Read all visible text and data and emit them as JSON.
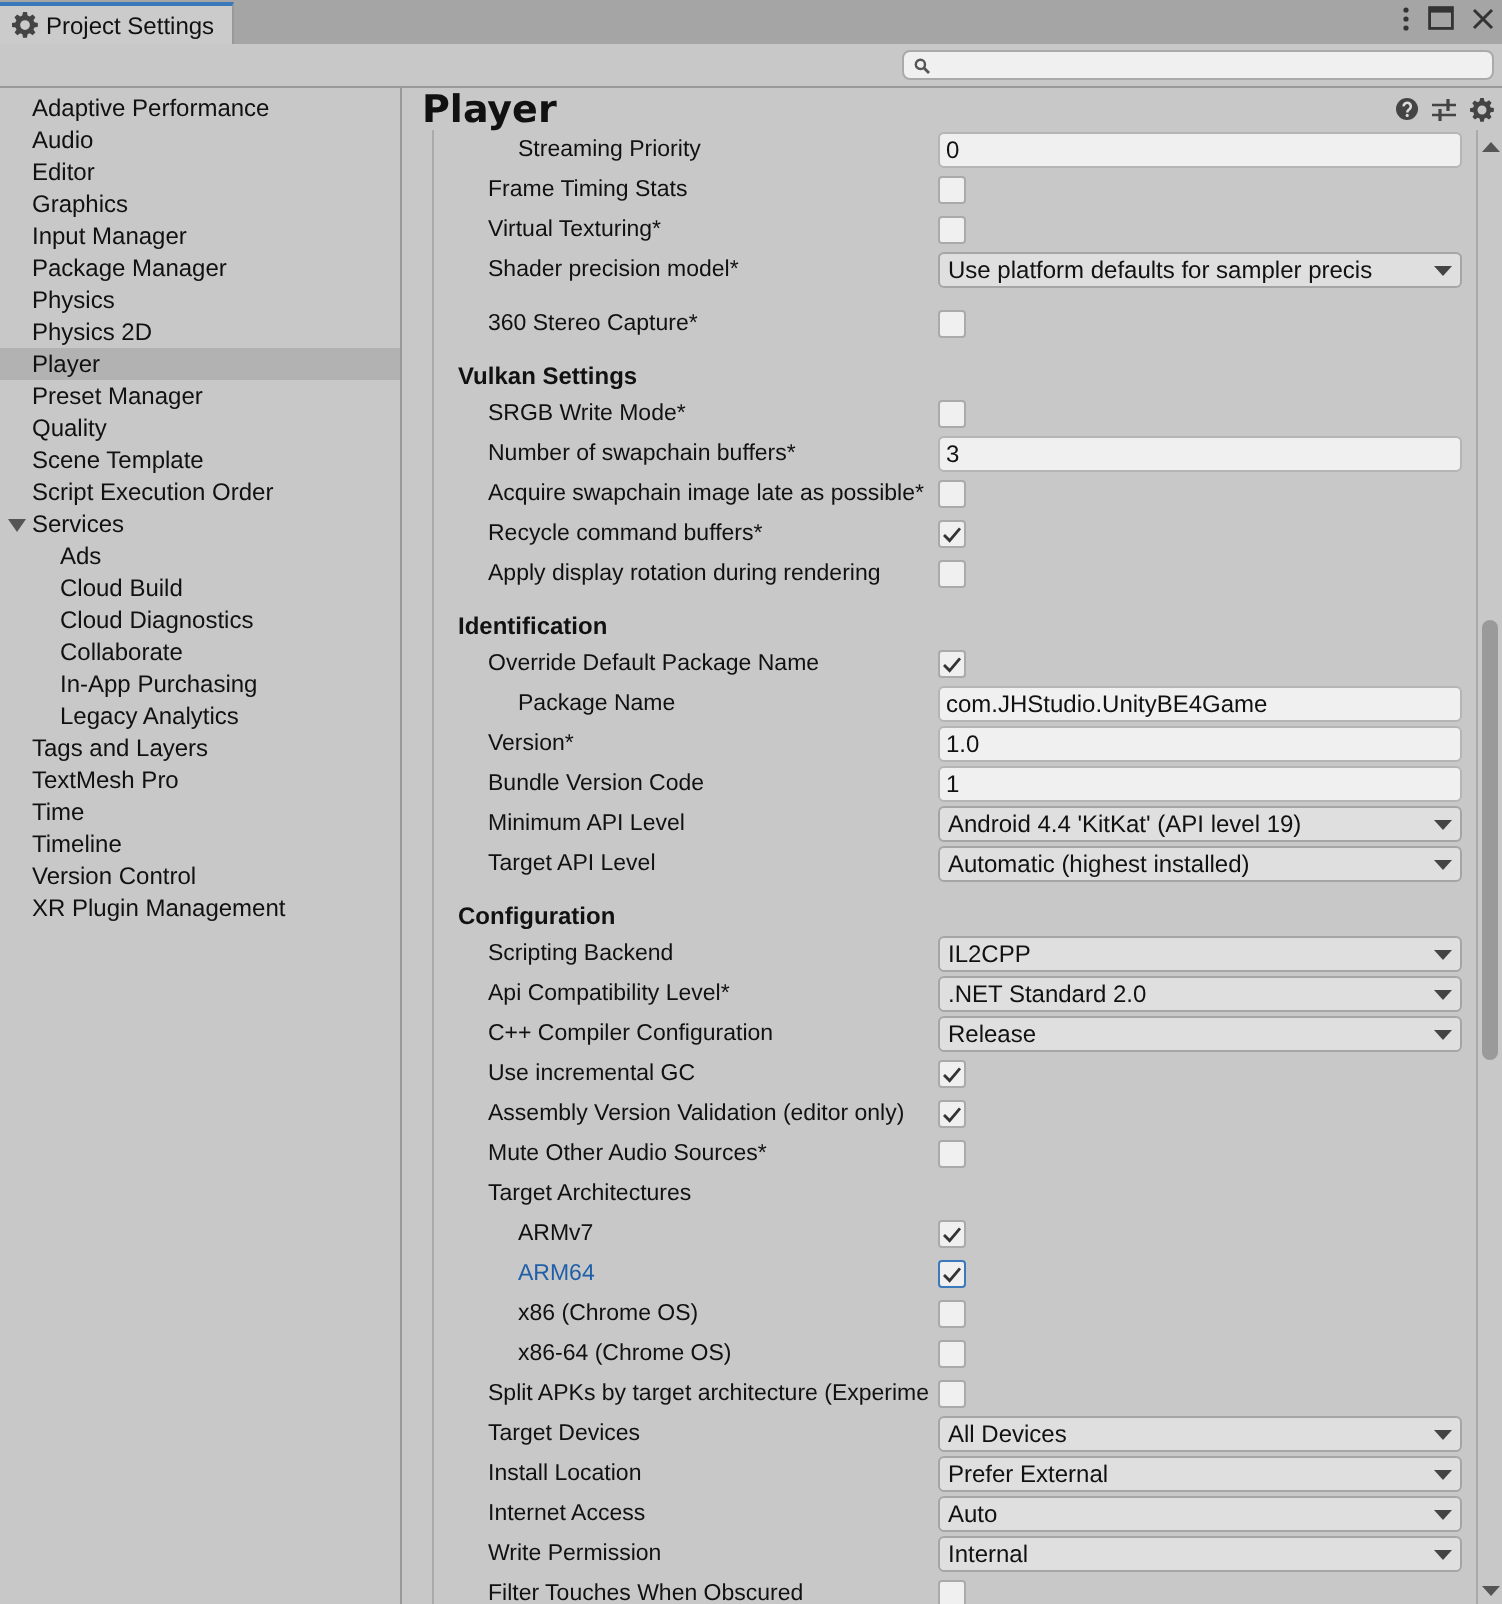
{
  "tab": {
    "title": "Project Settings"
  },
  "sidebar": {
    "items": [
      {
        "label": "Adaptive Performance",
        "selected": false
      },
      {
        "label": "Audio",
        "selected": false
      },
      {
        "label": "Editor",
        "selected": false
      },
      {
        "label": "Graphics",
        "selected": false
      },
      {
        "label": "Input Manager",
        "selected": false
      },
      {
        "label": "Package Manager",
        "selected": false
      },
      {
        "label": "Physics",
        "selected": false
      },
      {
        "label": "Physics 2D",
        "selected": false
      },
      {
        "label": "Player",
        "selected": true
      },
      {
        "label": "Preset Manager",
        "selected": false
      },
      {
        "label": "Quality",
        "selected": false
      },
      {
        "label": "Scene Template",
        "selected": false
      },
      {
        "label": "Script Execution Order",
        "selected": false
      },
      {
        "label": "Services",
        "selected": false,
        "expanded": true,
        "children": [
          {
            "label": "Ads",
            "selected": false
          },
          {
            "label": "Cloud Build",
            "selected": false
          },
          {
            "label": "Cloud Diagnostics",
            "selected": false
          },
          {
            "label": "Collaborate",
            "selected": false
          },
          {
            "label": "In-App Purchasing",
            "selected": false
          },
          {
            "label": "Legacy Analytics",
            "selected": false
          }
        ]
      },
      {
        "label": "Tags and Layers",
        "selected": false
      },
      {
        "label": "TextMesh Pro",
        "selected": false
      },
      {
        "label": "Time",
        "selected": false
      },
      {
        "label": "Timeline",
        "selected": false
      },
      {
        "label": "Version Control",
        "selected": false
      },
      {
        "label": "XR Plugin Management",
        "selected": false
      }
    ]
  },
  "inspector": {
    "title": "Player",
    "sections": [
      {
        "rows": [
          {
            "kind": "group",
            "children": [
              {
                "kind": "field",
                "label": "Streaming Priority",
                "value": "0"
              }
            ]
          },
          {
            "kind": "checkbox",
            "label": "Frame Timing Stats",
            "checked": false
          },
          {
            "kind": "checkbox",
            "label": "Virtual Texturing*",
            "checked": false
          },
          {
            "kind": "dropdown",
            "label": "Shader precision model*",
            "value": "Use platform defaults for sampler precis"
          }
        ]
      },
      {
        "rows": [
          {
            "kind": "checkbox",
            "label": "360 Stereo Capture*",
            "checked": false
          }
        ]
      },
      {
        "title": "Vulkan Settings",
        "rows": [
          {
            "kind": "checkbox",
            "label": "SRGB Write Mode*",
            "checked": false
          },
          {
            "kind": "field",
            "label": "Number of swapchain buffers*",
            "value": "3"
          },
          {
            "kind": "checkbox",
            "label": "Acquire swapchain image late as possible*",
            "checked": false
          },
          {
            "kind": "checkbox",
            "label": "Recycle command buffers*",
            "checked": true
          },
          {
            "kind": "checkbox",
            "label": "Apply display rotation during rendering",
            "checked": false
          }
        ]
      },
      {
        "title": "Identification",
        "rows": [
          {
            "kind": "checkbox",
            "label": "Override Default Package Name",
            "checked": true,
            "children": [
              {
                "kind": "field",
                "label": "Package Name",
                "value": "com.JHStudio.UnityBE4Game"
              }
            ]
          },
          {
            "kind": "field",
            "label": "Version*",
            "value": "1.0"
          },
          {
            "kind": "field",
            "label": "Bundle Version Code",
            "value": "1"
          },
          {
            "kind": "dropdown",
            "label": "Minimum API Level",
            "value": "Android 4.4 'KitKat' (API level 19)"
          },
          {
            "kind": "dropdown",
            "label": "Target API Level",
            "value": "Automatic (highest installed)"
          }
        ]
      },
      {
        "title": "Configuration",
        "rows": [
          {
            "kind": "dropdown",
            "label": "Scripting Backend",
            "value": "IL2CPP"
          },
          {
            "kind": "dropdown",
            "label": "Api Compatibility Level*",
            "value": ".NET Standard 2.0"
          },
          {
            "kind": "dropdown",
            "label": "C++ Compiler Configuration",
            "value": "Release"
          },
          {
            "kind": "checkbox",
            "label": "Use incremental GC",
            "checked": true
          },
          {
            "kind": "checkbox",
            "label": "Assembly Version Validation (editor only)",
            "checked": true
          },
          {
            "kind": "checkbox",
            "label": "Mute Other Audio Sources*",
            "checked": false
          },
          {
            "kind": "label",
            "label": "Target Architectures",
            "children": [
              {
                "kind": "checkbox",
                "label": "ARMv7",
                "checked": true,
                "focused": false
              },
              {
                "kind": "checkbox",
                "label": "ARM64",
                "checked": true,
                "focused": true
              },
              {
                "kind": "checkbox",
                "label": "x86 (Chrome OS)",
                "checked": false,
                "focused": false
              },
              {
                "kind": "checkbox",
                "label": "x86-64 (Chrome OS)",
                "checked": false,
                "focused": false
              }
            ]
          },
          {
            "kind": "checkbox",
            "label": "Split APKs by target architecture (Experime",
            "checked": false
          },
          {
            "kind": "dropdown",
            "label": "Target Devices",
            "value": "All Devices"
          },
          {
            "kind": "dropdown",
            "label": "Install Location",
            "value": "Prefer External"
          },
          {
            "kind": "dropdown",
            "label": "Internet Access",
            "value": "Auto"
          },
          {
            "kind": "dropdown",
            "label": "Write Permission",
            "value": "Internal"
          },
          {
            "kind": "checkbox",
            "label": "Filter Touches When Obscured",
            "checked": false
          }
        ]
      }
    ]
  }
}
